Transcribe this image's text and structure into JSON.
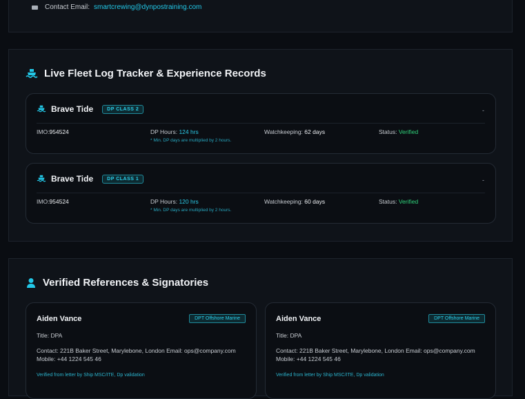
{
  "contact": {
    "label": "Contact Email:",
    "email": "smartcrewing@dynpostraining.com"
  },
  "fleet": {
    "title": "Live Fleet Log Tracker & Experience Records",
    "vessels": [
      {
        "name": "Brave Tide",
        "dp_class": "DP CLASS 2",
        "dash": "-",
        "imo_label": "IMO:",
        "imo": "954524",
        "dp_hours_label": "DP Hours:",
        "dp_hours": "124 hrs",
        "note": "* Min. DP days are multiplied by 2 hours.",
        "watch_label": "Watchkeeping:",
        "watch": "62 days",
        "status_label": "Status:",
        "status": "Verified"
      },
      {
        "name": "Brave Tide",
        "dp_class": "DP CLASS 1",
        "dash": "-",
        "imo_label": "IMO:",
        "imo": "954524",
        "dp_hours_label": "DP Hours:",
        "dp_hours": "120 hrs",
        "note": "* Min. DP days are multiplied by 2 hours.",
        "watch_label": "Watchkeeping:",
        "watch": "60 days",
        "status_label": "Status:",
        "status": "Verified"
      }
    ]
  },
  "references": {
    "title": "Verified References & Signatories",
    "cards": [
      {
        "name": "Aiden Vance",
        "badge": "DPT Offshore Marine",
        "title_label": "Title:",
        "title": "DPA",
        "contact_label": "Contact:",
        "contact": "221B Baker Street, Marylebone, London Email: ops@company.com Mobile: +44 1224 545 46",
        "link": "Verified from letter by Ship MSC/ITE, Dp validation"
      },
      {
        "name": "Aiden Vance",
        "badge": "DPT Offshore Marine",
        "title_label": "Title:",
        "title": "DPA",
        "contact_label": "Contact:",
        "contact": "221B Baker Street, Marylebone, London Email: ops@company.com Mobile: +44 1224 545 46",
        "link": "Verified from letter by Ship MSC/ITE, Dp validation"
      }
    ]
  },
  "colors": {
    "accent": "#22c8e8",
    "verified": "#2fd37a",
    "panel": "#0f1319",
    "background": "#0a0d12"
  }
}
